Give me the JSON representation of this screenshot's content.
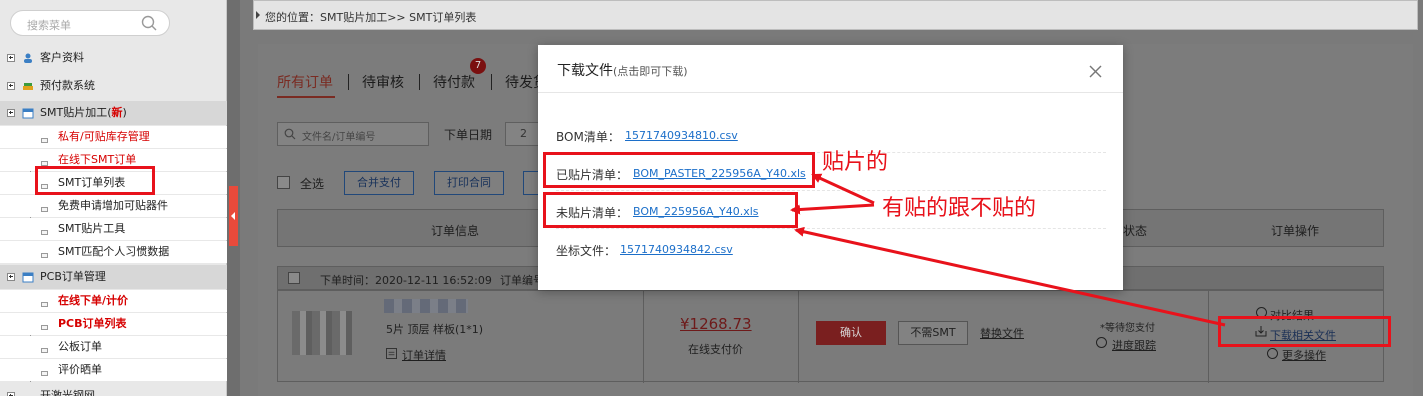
{
  "sidebar": {
    "search_placeholder": "搜索菜单",
    "groups": [
      {
        "label": "客户资料"
      },
      {
        "label": "预付款系统"
      },
      {
        "label": "SMT贴片加工(",
        "badge": "新",
        "suffix": ")"
      },
      {
        "label": "PCB订单管理"
      },
      {
        "label": "开激光钢网"
      }
    ],
    "smt_items": [
      {
        "label": "私有/可贴库存管理"
      },
      {
        "label": "在线下SMT订单"
      },
      {
        "label": "SMT订单列表"
      },
      {
        "label": "免费申请增加可贴器件"
      },
      {
        "label": "SMT贴片工具"
      },
      {
        "label": "SMT匹配个人习惯数据"
      }
    ],
    "pcb_items": [
      {
        "label": "在线下单/计价"
      },
      {
        "label": "PCB订单列表"
      },
      {
        "label": "公板订单"
      },
      {
        "label": "评价晒单"
      }
    ]
  },
  "breadcrumb": {
    "text": "您的位置：SMT贴片加工>> SMT订单列表"
  },
  "tabs": [
    {
      "label": "所有订单"
    },
    {
      "label": "待审核"
    },
    {
      "label": "待付款",
      "badge": "7"
    },
    {
      "label": "待发货"
    }
  ],
  "filters": {
    "search_placeholder": "文件名/订单编号",
    "date_label": "下单日期",
    "date_value": "2"
  },
  "actions": {
    "select_all": "全选",
    "merge_pay": "合并支付",
    "print_contract": "打印合同"
  },
  "table": {
    "headers": [
      "订单信息",
      "状态",
      "订单操作"
    ]
  },
  "order": {
    "order_time": "下单时间：2020-12-11 16:52:09",
    "order_no_label": "订单编号",
    "spec": "5片 顶层 样板(1*1)",
    "detail_link": "订单详情",
    "price": "¥1268.73",
    "price_note": "在线支付价",
    "confirm": "确认",
    "no_smt": "不需SMT",
    "replace_file": "替换文件",
    "status": "*等待您支付",
    "progress": "进度跟踪",
    "compare": "对比结果",
    "download_related": "下载相关文件",
    "more_ops": "更多操作"
  },
  "modal": {
    "title": "下载文件",
    "subtitle": "(点击即可下载)",
    "rows": [
      {
        "label": "BOM清单：",
        "file": "1571740934810.csv"
      },
      {
        "label": "已贴片清单：",
        "file": "BOM_PASTER_225956A_Y40.xls"
      },
      {
        "label": "未贴片清单：",
        "file": "BOM_225956A_Y40.xls"
      },
      {
        "label": "坐标文件：",
        "file": "1571740934842.csv"
      }
    ]
  },
  "annotations": {
    "pasted_note": "贴片的",
    "compare_note": "有贴的跟不贴的"
  },
  "colors": {
    "annotation": "#e8121b",
    "link": "#1c6fc9",
    "menu_red": "#d60000"
  }
}
